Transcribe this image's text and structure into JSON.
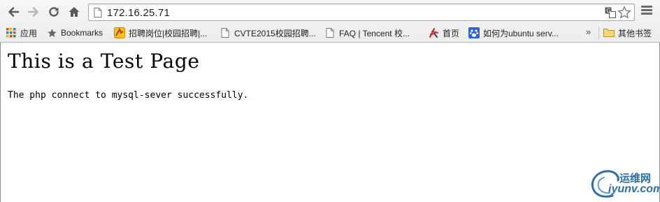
{
  "browser": {
    "address_bar": {
      "url": "172.16.25.71"
    },
    "bookmarks": [
      {
        "label": "应用",
        "icon": "apps-grid-icon"
      },
      {
        "label": "Bookmarks",
        "icon": "star-icon"
      },
      {
        "label": "招聘岗位|校园招聘|...",
        "icon": "site-favicon-icon"
      },
      {
        "label": "CVTE2015校园招聘...",
        "icon": "page-icon"
      },
      {
        "label": "FAQ | Tencent 校...",
        "icon": "page-icon"
      },
      {
        "label": "首页",
        "icon": "site-favicon-icon"
      },
      {
        "label": "如何为ubuntu serv...",
        "icon": "baidu-paw-icon"
      }
    ],
    "overflow_label": "»",
    "other_bookmarks": "其他书签"
  },
  "page": {
    "heading": "This is a Test Page",
    "message": "The php connect to mysql-sever successfully."
  },
  "watermark": {
    "cn": "运维网",
    "en": "iyunv.com"
  },
  "colors": {
    "chrome_bg": "#ececec",
    "watermark": "#2c6ea8"
  }
}
